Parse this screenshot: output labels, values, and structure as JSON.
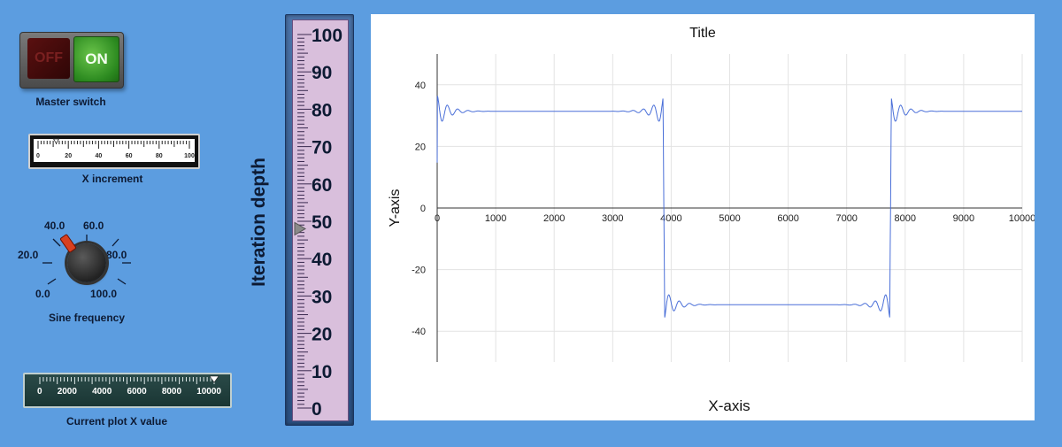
{
  "master_switch": {
    "off_label": "OFF",
    "on_label": "ON",
    "state": "on",
    "label": "Master switch"
  },
  "x_increment": {
    "label": "X increment",
    "min": 0,
    "max": 100,
    "value": 12,
    "ticks": [
      "0",
      "20",
      "40",
      "60",
      "80",
      "100"
    ]
  },
  "sine_frequency": {
    "label": "Sine frequency",
    "value": 40.0,
    "scale": [
      "0.0",
      "20.0",
      "40.0",
      "60.0",
      "80.0",
      "100.0"
    ]
  },
  "current_x": {
    "label": "Current plot X value",
    "value": 10000,
    "ticks": [
      "0",
      "2000",
      "4000",
      "6000",
      "8000",
      "10000"
    ]
  },
  "iteration_depth": {
    "label": "Iteration depth",
    "value": 48,
    "ticks": [
      "0",
      "10",
      "20",
      "30",
      "40",
      "50",
      "60",
      "70",
      "80",
      "90",
      "100"
    ]
  },
  "chart_data": {
    "type": "line",
    "title": "Title",
    "xlabel": "X-axis",
    "ylabel": "Y-axis",
    "xlim": [
      0,
      10000
    ],
    "ylim": [
      -50,
      50
    ],
    "xticks": [
      "0",
      "1000",
      "2000",
      "3000",
      "4000",
      "5000",
      "6000",
      "7000",
      "8000",
      "9000",
      "10000"
    ],
    "yticks": [
      "40",
      "20",
      "0",
      "-20",
      "-40"
    ],
    "grid": true,
    "series": [
      {
        "color": "#4a6fd8",
        "amplitude": 31.4,
        "period": 7750,
        "transitions": [
          0,
          3875,
          7750
        ],
        "x": [
          0,
          60,
          3800,
          3860,
          3875,
          3890,
          3950,
          7690,
          7740,
          7750,
          7760,
          7820,
          10000
        ],
        "y": [
          14.7,
          36.5,
          31.4,
          36.5,
          0,
          -36.5,
          -31.4,
          -31.4,
          -36.5,
          0,
          36.5,
          31.4,
          31.4
        ]
      }
    ]
  }
}
